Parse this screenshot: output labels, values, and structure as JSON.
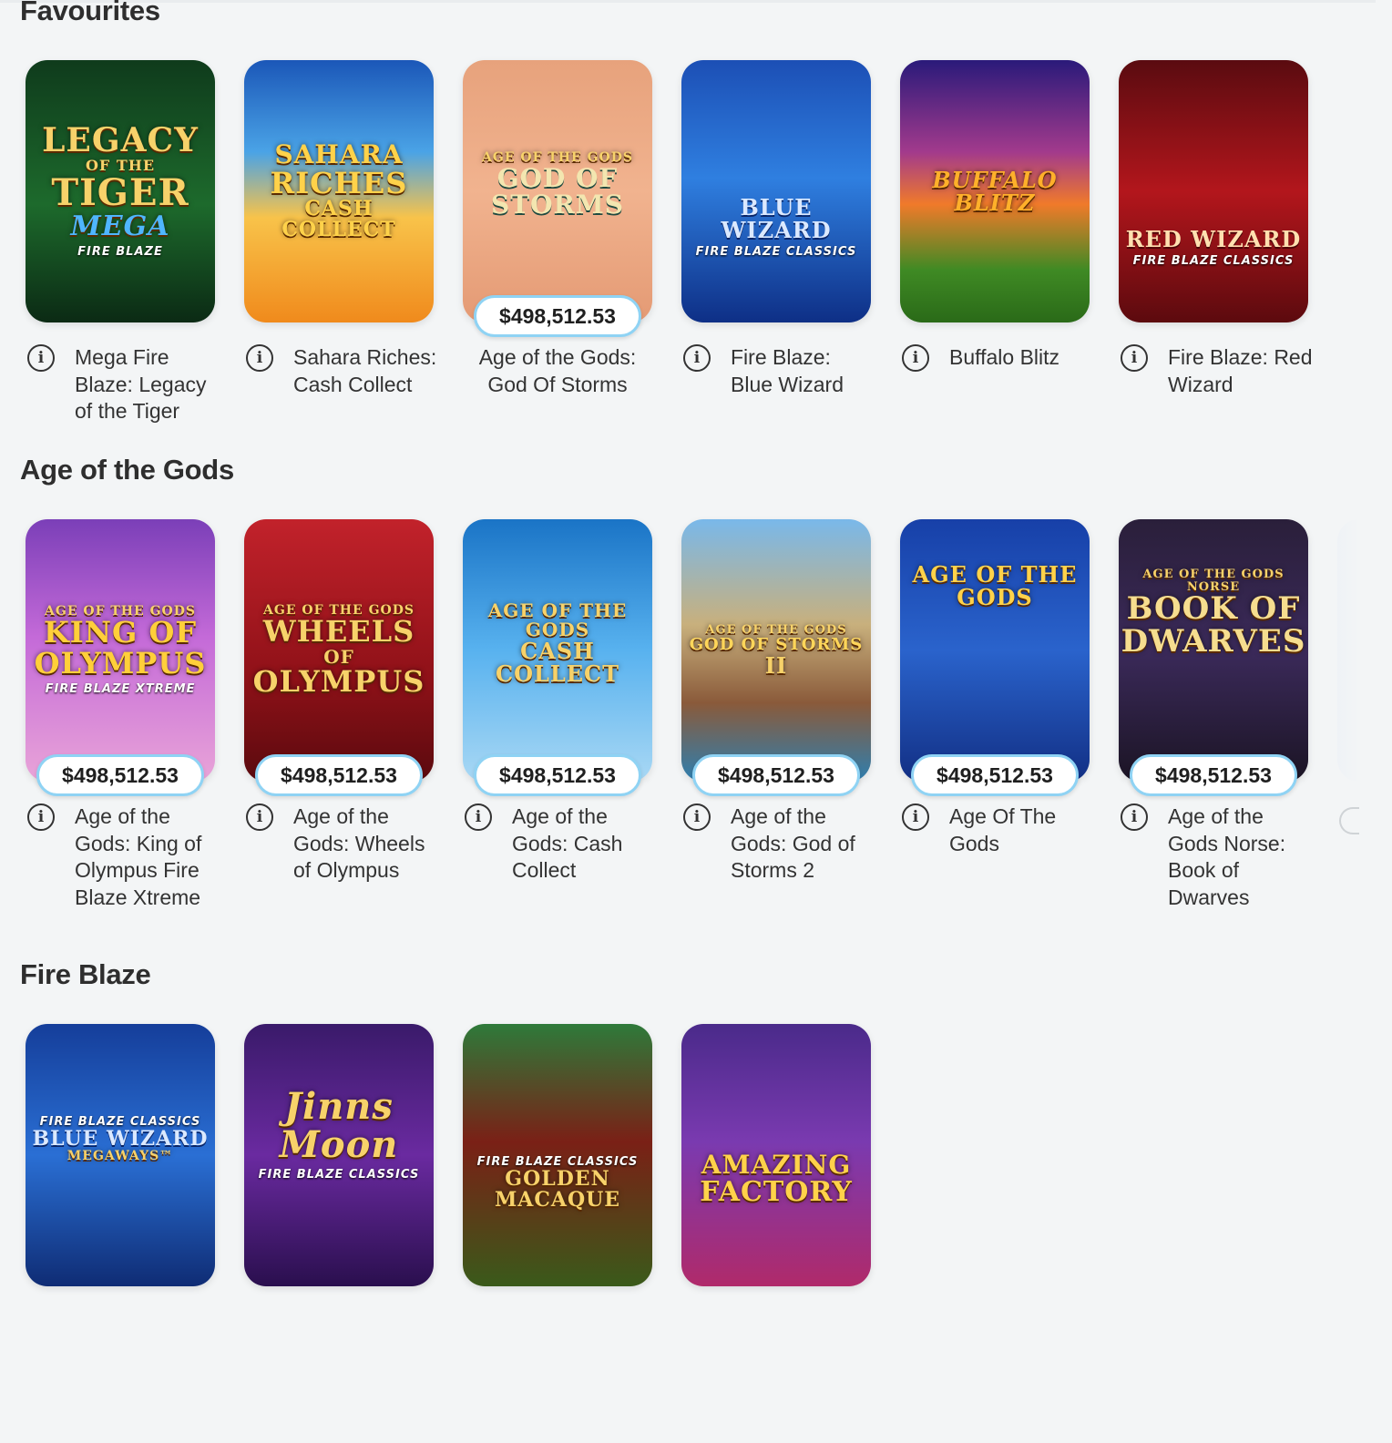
{
  "sections": [
    {
      "title": "Favourites",
      "games": [
        {
          "title": "Mega Fire Blaze: Legacy of the Tiger",
          "jackpot": null,
          "info_icon": "info-icon",
          "art": {
            "lines": [
              "LEGACY",
              "OF THE",
              "TIGER",
              "MEGA"
            ],
            "sub": "FIRE BLAZE",
            "bg": "linear-gradient(180deg,#0f3b1c 0%,#1d6a2c 55%,#0b2a14 100%)"
          }
        },
        {
          "title": "Sahara Riches: Cash Collect",
          "jackpot": null,
          "info_icon": "info-icon",
          "art": {
            "lines": [
              "SAHARA",
              "RICHES",
              "CASH COLLECT"
            ],
            "sub": "",
            "bg": "linear-gradient(180deg,#1b57b8 0%,#4aa3e6 35%,#f8c34a 60%,#f08a1c 100%)"
          }
        },
        {
          "title": "Age of the Gods: God Of Storms",
          "jackpot": "$498,512.53",
          "info_icon": null,
          "art": {
            "lines": [
              "AGE OF THE GODS",
              "GOD OF",
              "STORMS"
            ],
            "sub": "",
            "bg": "linear-gradient(180deg,#e7a27c 0%,#f1b38f 50%,#e49a74 100%)"
          }
        },
        {
          "title": "Fire Blaze: Blue Wizard",
          "jackpot": null,
          "info_icon": "info-icon",
          "art": {
            "lines": [
              "BLUE WIZARD"
            ],
            "sub": "FIRE BLAZE CLASSICS",
            "bg": "linear-gradient(180deg,#1c4fb5 0%,#2f7fe0 45%,#0e2f86 100%)"
          }
        },
        {
          "title": "Buffalo Blitz",
          "jackpot": null,
          "info_icon": "info-icon",
          "art": {
            "lines": [
              "BUFFALO BLITZ"
            ],
            "sub": "",
            "bg": "linear-gradient(180deg,#2a1a7a 0%,#a23a8c 35%,#f07a2a 55%,#3f8a24 80%,#2a6a18 100%)"
          }
        },
        {
          "title": "Fire Blaze: Red Wizard",
          "jackpot": null,
          "info_icon": "info-icon",
          "art": {
            "lines": [
              "RED WIZARD"
            ],
            "sub": "FIRE BLAZE CLASSICS",
            "bg": "linear-gradient(180deg,#5a0b10 0%,#b3161c 50%,#5c0a0e 100%)"
          }
        }
      ]
    },
    {
      "title": "Age of the Gods",
      "games": [
        {
          "title": "Age of the Gods: King of Olympus Fire Blaze Xtreme",
          "jackpot": "$498,512.53",
          "info_icon": "info-icon",
          "art": {
            "lines": [
              "AGE OF THE GODS",
              "KING OF",
              "OLYMPUS"
            ],
            "sub": "FIRE BLAZE XTREME",
            "bg": "linear-gradient(180deg,#7b3fb8 0%,#c46ad8 45%,#e9a4d8 100%)"
          }
        },
        {
          "title": "Age of the Gods: Wheels of Olympus",
          "jackpot": "$498,512.53",
          "info_icon": "info-icon",
          "art": {
            "lines": [
              "AGE OF THE GODS",
              "WHEELS",
              "OF",
              "OLYMPUS"
            ],
            "sub": "",
            "bg": "linear-gradient(180deg,#c2222b 0%,#8f1118 60%,#5a0a0e 100%)"
          }
        },
        {
          "title": "Age of the Gods: Cash Collect",
          "jackpot": "$498,512.53",
          "info_icon": "info-icon",
          "art": {
            "lines": [
              "AGE OF THE GODS",
              "CASH COLLECT"
            ],
            "sub": "",
            "bg": "linear-gradient(180deg,#1a74c6 0%,#58b2ef 50%,#a9d8f4 100%)"
          }
        },
        {
          "title": "Age of the Gods: God of Storms 2",
          "jackpot": "$498,512.53",
          "info_icon": "info-icon",
          "art": {
            "lines": [
              "AGE OF THE GODS",
              "GOD OF STORMS",
              "II"
            ],
            "sub": "",
            "bg": "linear-gradient(180deg,#79b8ea 0%,#c8b07d 40%,#8a5a3a 70%,#2e7fb0 100%)"
          }
        },
        {
          "title": "Age Of The Gods",
          "jackpot": "$498,512.53",
          "info_icon": "info-icon",
          "art": {
            "lines": [
              "AGE OF THE GODS"
            ],
            "sub": "",
            "bg": "linear-gradient(180deg,#1740a8 0%,#2a63cc 50%,#122f84 100%)"
          }
        },
        {
          "title": "Age of the Gods Norse: Book of Dwarves",
          "jackpot": "$498,512.53",
          "info_icon": "info-icon",
          "art": {
            "lines": [
              "AGE OF THE GODS NORSE",
              "BOOK OF",
              "DWARVES"
            ],
            "sub": "",
            "bg": "linear-gradient(180deg,#2a1f3a 0%,#3b2a5a 50%,#1b1424 100%)"
          }
        }
      ]
    },
    {
      "title": "Fire Blaze",
      "games": [
        {
          "title": "",
          "jackpot": null,
          "info_icon": null,
          "art": {
            "lines": [
              "BLUE WIZARD",
              "MEGAWAYS™"
            ],
            "sub": "FIRE BLAZE CLASSICS",
            "bg": "linear-gradient(180deg,#153e9a 0%,#2a6fd4 50%,#0f2c74 100%)"
          }
        },
        {
          "title": "",
          "jackpot": null,
          "info_icon": null,
          "art": {
            "lines": [
              "Jinns",
              "Moon"
            ],
            "sub": "FIRE BLAZE CLASSICS",
            "bg": "linear-gradient(180deg,#3a1a6a 0%,#6a2aa0 50%,#2a0f4e 100%)"
          }
        },
        {
          "title": "",
          "jackpot": null,
          "info_icon": null,
          "art": {
            "lines": [
              "GOLDEN",
              "MACAQUE"
            ],
            "sub": "FIRE BLAZE CLASSICS",
            "bg": "linear-gradient(180deg,#2e7a3a 0%,#7a2016 45%,#3a5a1a 100%)"
          }
        },
        {
          "title": "",
          "jackpot": null,
          "info_icon": null,
          "art": {
            "lines": [
              "AMAZING",
              "FACTORY"
            ],
            "sub": "",
            "bg": "linear-gradient(180deg,#4a2a8a 0%,#7a3ab0 45%,#b02a6a 100%)"
          }
        }
      ]
    }
  ]
}
